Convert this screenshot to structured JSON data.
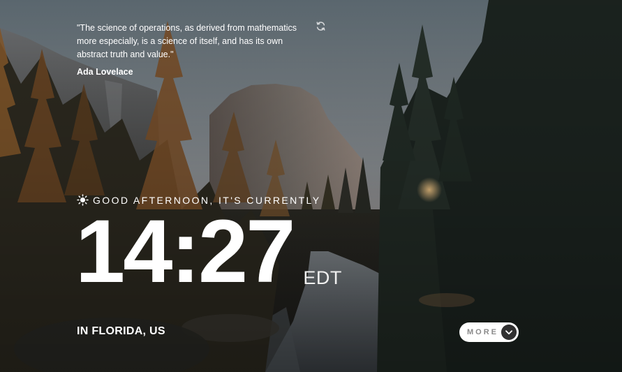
{
  "quote": {
    "text": "\"The science of operations, as derived from mathematics more especially, is a science of itself, and has its own abstract truth and value.\"",
    "author": "Ada Lovelace"
  },
  "greeting": {
    "icon": "sun-icon",
    "text": "GOOD AFTERNOON, IT'S CURRENTLY"
  },
  "time": {
    "clock": "14:27",
    "timezone": "EDT"
  },
  "location": "IN FLORIDA, US",
  "more_button": {
    "label": "MORE",
    "icon": "chevron-down-icon"
  },
  "colors": {
    "text": "#ffffff",
    "button_bg": "#ffffff",
    "button_text": "#8a8a8a",
    "chevron_bg": "#303030"
  }
}
